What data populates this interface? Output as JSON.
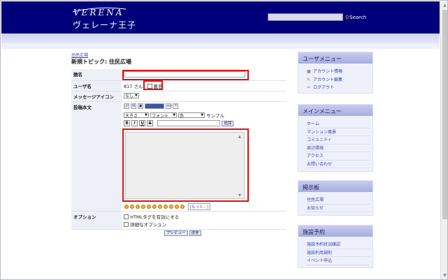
{
  "header": {
    "logo_en": "VERENA",
    "logo_ja": "ヴェレーナ王子",
    "search_placeholder": "",
    "search_label": "Search"
  },
  "breadcrumb": "住民広場",
  "page_title": "新規トピック: 住民広場",
  "form": {
    "subject_label": "題名",
    "username_label": "ユーザ名",
    "username_value": "817 さん",
    "anonymous_label": "匿名",
    "icon_label": "メッセージアイコン",
    "icon_value": "なし",
    "body_label": "投稿本文",
    "size_select": "大きさ",
    "font_select": "フォント",
    "color_select": "色",
    "sample_label": "サンプル",
    "bold": "B",
    "italic": "I",
    "underline": "U",
    "strike": "S",
    "add_button": "追加",
    "more_smileys": "[もっと...]",
    "options_label": "オプション",
    "html_option": "HTMLタグを有効にする",
    "detail_option": "詳細なオプション",
    "preview_button": "プレビュー",
    "submit_button": "送信"
  },
  "sidebar": {
    "user_menu": {
      "title": "ユーザメニュー",
      "items": [
        "アカウント情報",
        "アカウント編集",
        "ログアウト"
      ]
    },
    "main_menu": {
      "title": "メインメニュー",
      "items": [
        "ホーム",
        "マンション風景",
        "コミュニティ",
        "周辺環境",
        "アクセス",
        "お問い合わせ"
      ]
    },
    "board": {
      "title": "掲示板",
      "items": [
        "住民広場",
        "お知らせ"
      ]
    },
    "facility": {
      "title": "施設予約",
      "items": [
        "施設予約状況確認",
        "施設利用規則",
        "イベント申込"
      ]
    }
  }
}
